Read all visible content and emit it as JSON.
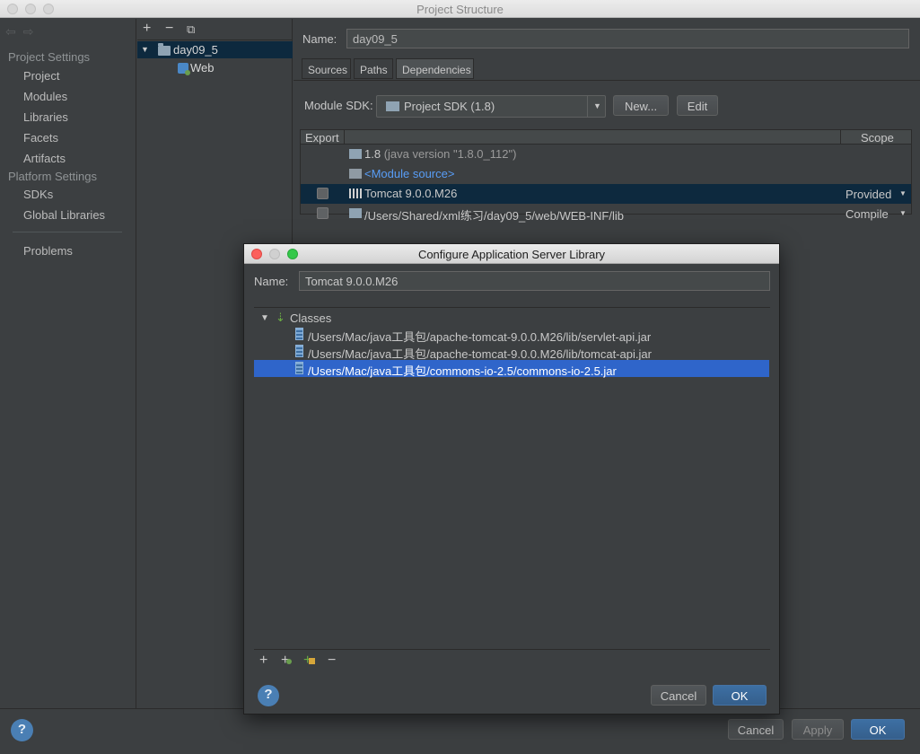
{
  "window": {
    "title": "Project Structure"
  },
  "sidebar": {
    "sections": [
      {
        "header": "Project Settings",
        "items": [
          "Project",
          "Modules",
          "Libraries",
          "Facets",
          "Artifacts"
        ]
      },
      {
        "header": "Platform Settings",
        "items": [
          "SDKs",
          "Global Libraries"
        ]
      }
    ],
    "problems": "Problems"
  },
  "modules": {
    "tree": [
      {
        "label": "day09_5"
      },
      {
        "label": "Web"
      }
    ]
  },
  "module_panel": {
    "name_label": "Name:",
    "name_value": "day09_5",
    "tabs": [
      "Sources",
      "Paths",
      "Dependencies"
    ],
    "active_tab": "Dependencies",
    "sdk_label": "Module SDK:",
    "sdk_value": "Project SDK (1.8)",
    "new_button": "New...",
    "edit_button": "Edit",
    "table": {
      "headers": {
        "export": "Export",
        "scope": "Scope"
      },
      "rows": [
        {
          "name": "1.8",
          "detail": "(java version \"1.8.0_112\")",
          "scope": ""
        },
        {
          "name": "<Module source>",
          "detail": "",
          "scope": ""
        },
        {
          "name": "Tomcat 9.0.0.M26",
          "detail": "",
          "scope": "Provided"
        },
        {
          "name": "/Users/Shared/xml练习/day09_5/web/WEB-INF/lib",
          "detail": "",
          "scope": "Compile"
        }
      ]
    }
  },
  "footer": {
    "cancel": "Cancel",
    "apply": "Apply",
    "ok": "OK",
    "help": "?"
  },
  "dialog": {
    "title": "Configure Application Server Library",
    "name_label": "Name:",
    "name_value": "Tomcat 9.0.0.M26",
    "classes_label": "Classes",
    "jars": [
      "/Users/Mac/java工具包/apache-tomcat-9.0.0.M26/lib/servlet-api.jar",
      "/Users/Mac/java工具包/apache-tomcat-9.0.0.M26/lib/tomcat-api.jar",
      "/Users/Mac/java工具包/commons-io-2.5/commons-io-2.5.jar"
    ],
    "toolbar": {
      "add": "+",
      "remove": "−"
    },
    "cancel": "Cancel",
    "ok": "OK",
    "help": "?"
  }
}
